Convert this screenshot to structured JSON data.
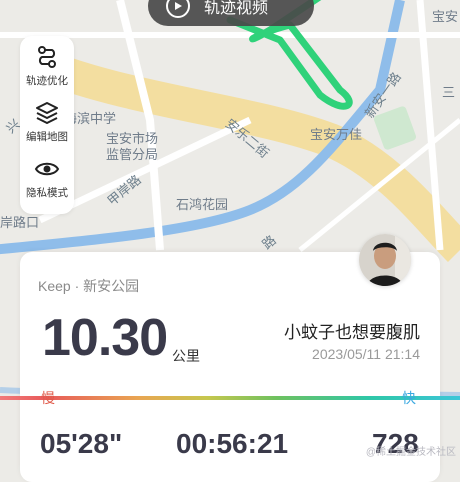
{
  "map": {
    "labels": [
      {
        "id": "shenzhen-middle-school",
        "text": "海滨中学"
      },
      {
        "id": "baoan-market",
        "text": "宝安市场"
      },
      {
        "id": "regulatory-branch",
        "text": "监管分局"
      },
      {
        "id": "anle-second-street",
        "text": "安乐二街"
      },
      {
        "id": "baoan-wanjia",
        "text": "宝安万佳"
      },
      {
        "id": "xinan-first-road",
        "text": "新安一路"
      },
      {
        "id": "jiangan-road",
        "text": "甲岸路"
      },
      {
        "id": "shihong-garden",
        "text": "石鸿花园"
      },
      {
        "id": "anlu-kou",
        "text": "岸路口"
      },
      {
        "id": "bao-corner",
        "text": "宝安"
      },
      {
        "id": "san-corner",
        "text": "三"
      },
      {
        "id": "road-fragment",
        "text": "路"
      },
      {
        "id": "xing-fragment",
        "text": "兴"
      }
    ]
  },
  "top_button": {
    "label": "轨迹视频"
  },
  "toolbar": {
    "items": [
      {
        "label": "轨迹优化",
        "icon": "track-optimize-icon"
      },
      {
        "label": "编辑地图",
        "icon": "layers-icon"
      },
      {
        "label": "隐私模式",
        "icon": "eye-icon"
      }
    ]
  },
  "card": {
    "source": "Keep · 新安公园",
    "distance": "10.30",
    "distance_unit": "公里",
    "username": "小蚊子也想要腹肌",
    "datetime": "2023/05/11 21:14"
  },
  "pace_scale": {
    "slow": "慢",
    "fast": "快"
  },
  "stats": {
    "pace": "05'28\"",
    "duration": "00:56:21",
    "value": "728"
  },
  "watermark": "@稀土掘金技术社区",
  "colors": {
    "route": "#2fd27a",
    "accent_green": "#2fd27a",
    "river": "#7fb3e8",
    "road": "#f3d98a"
  }
}
